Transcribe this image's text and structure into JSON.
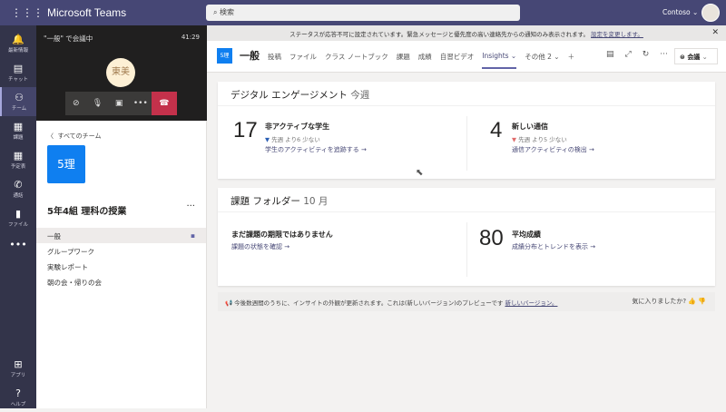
{
  "app": {
    "title": "Microsoft Teams",
    "search_placeholder": "検索",
    "org": "Contoso ⌄"
  },
  "rail": [
    {
      "label": "最新情報",
      "icon": "bell-icon",
      "glyph": "🔔"
    },
    {
      "label": "チャット",
      "icon": "chat-icon",
      "glyph": "▤"
    },
    {
      "label": "チーム",
      "icon": "teams-icon",
      "glyph": "⚇"
    },
    {
      "label": "課題",
      "icon": "assignments-icon",
      "glyph": "▦"
    },
    {
      "label": "予定表",
      "icon": "calendar-icon",
      "glyph": "▦"
    },
    {
      "label": "通話",
      "icon": "phone-icon",
      "glyph": "✆"
    },
    {
      "label": "ファイル",
      "icon": "file-icon",
      "glyph": "▮"
    },
    {
      "label": "",
      "icon": "more-icon",
      "glyph": "•••"
    },
    {
      "label": "アプリ",
      "icon": "apps-icon",
      "glyph": "⊞"
    },
    {
      "label": "ヘルプ",
      "icon": "help-icon",
      "glyph": "?"
    }
  ],
  "call": {
    "title": "\"一般\" で会議中",
    "time": "41:29",
    "avatar": "東美"
  },
  "panel": {
    "back": "すべてのチーム",
    "tile": "5理",
    "team": "5年4組 理科の授業",
    "channels": [
      "一般",
      "グループワーク",
      "実験レポート",
      "朝の会・帰りの会"
    ]
  },
  "banner": {
    "text": "ステータスが応答不可に設定されています。緊急メッセージと優先度の高い連絡先からの通知のみ表示されます。",
    "link": "設定を変更します。"
  },
  "header": {
    "tile": "5理",
    "channel": "一般",
    "tabs": [
      "投稿",
      "ファイル",
      "クラス ノートブック",
      "課題",
      "成績",
      "自習ビデオ",
      "Insights ⌄",
      "その他 2 ⌄",
      "＋"
    ],
    "active_tab": 6,
    "meet": "会議"
  },
  "engagement": {
    "title": "デジタル エンゲージメント",
    "period": "今週",
    "m1": {
      "value": "17",
      "label": "非アクティブな学生",
      "trend": "▼ 先週 より6 少ない",
      "link": "学生のアクティビティを追跡する →"
    },
    "m2": {
      "value": "4",
      "label": "新しい通信",
      "trend": "▼ 先週 より5 少ない",
      "link": "通信アクティビティの検出 →"
    }
  },
  "assignments": {
    "title": "課題 フォルダー",
    "period": "10 月",
    "m1": {
      "label": "まだ課題の期限ではありません",
      "link": "課題の状態を確認 →"
    },
    "m2": {
      "value": "80",
      "label": "平均成績",
      "link": "成績分布とトレンドを表示 →"
    }
  },
  "feedback": {
    "text": "今後数週間のうちに、インサイトの外観が更新されます。これは(新しいバージョン)のプレビューです",
    "link": "新しいバージョン。",
    "question": "気に入りましたか?"
  },
  "colors": {
    "brand": "#464775",
    "tile": "#0f7ff0",
    "hangup": "#c4314b",
    "trend_blue": "#2b5fb4",
    "trend_red": "#e06c6c"
  }
}
